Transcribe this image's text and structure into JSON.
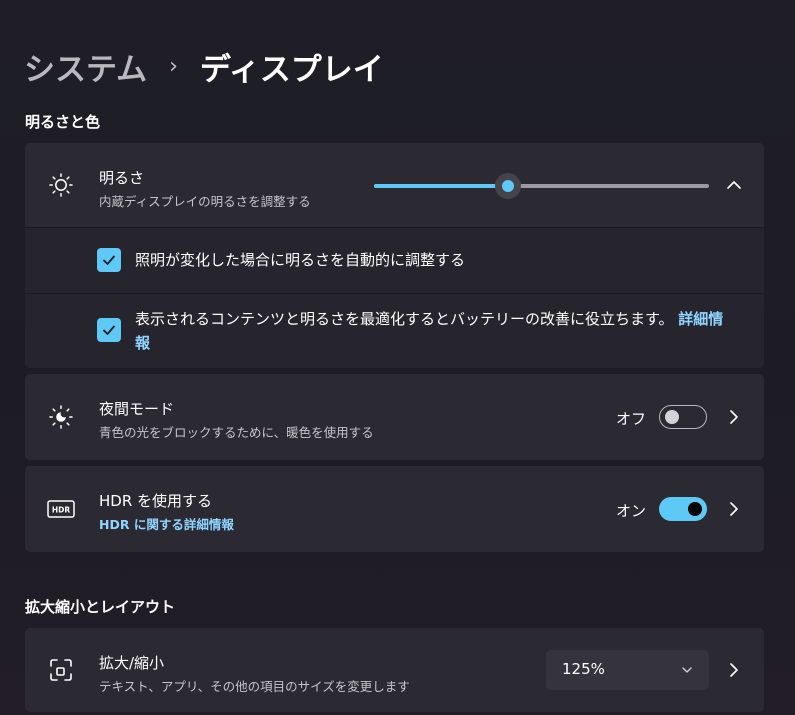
{
  "breadcrumb": {
    "parent": "システム",
    "separator": "›",
    "current": "ディスプレイ"
  },
  "sections": {
    "brightness_color": "明るさと色",
    "scale_layout": "拡大縮小とレイアウト"
  },
  "brightness": {
    "title": "明るさ",
    "subtitle": "内蔵ディスプレイの明るさを調整する",
    "slider_value_percent": 40,
    "icon": "sun-icon",
    "expand_icon": "chevron-up-icon"
  },
  "auto_brightness": {
    "checked": true,
    "label": "照明が変化した場合に明るさを自動的に調整する"
  },
  "content_adaptive": {
    "checked": true,
    "label": "表示されるコンテンツと明るさを最適化するとバッテリーの改善に役立ちます。",
    "link": "詳細情報"
  },
  "night_mode": {
    "title": "夜間モード",
    "subtitle": "青色の光をブロックするために、暖色を使用する",
    "state_label": "オフ",
    "on": false,
    "icon": "night-light-icon"
  },
  "hdr": {
    "title": "HDR を使用する",
    "link": "HDR に関する詳細情報",
    "state_label": "オン",
    "on": true,
    "icon": "hdr-icon",
    "icon_text": "HDR"
  },
  "scale": {
    "title": "拡大/縮小",
    "subtitle": "テキスト、アプリ、その他の項目のサイズを変更します",
    "value": "125%",
    "icon": "scale-icon"
  },
  "colors": {
    "accent": "#5ec8f7",
    "link": "#8fd5ff",
    "card": "#2b2a32",
    "sub_card": "#26252d"
  }
}
